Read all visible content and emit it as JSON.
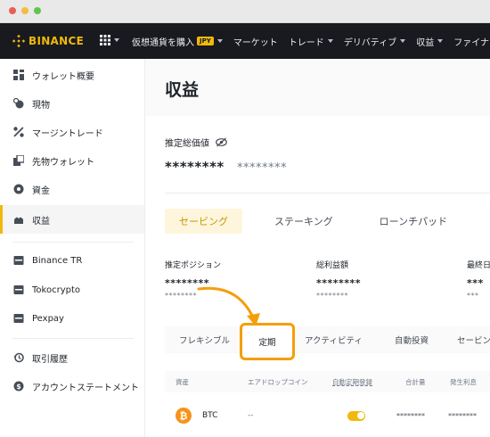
{
  "brand": {
    "name": "BINANCE",
    "accent": "#f0b90b"
  },
  "nav": {
    "items": [
      {
        "label": "仮想通貨を購入",
        "badge": "JPY",
        "has_caret": true
      },
      {
        "label": "マーケット",
        "has_caret": false
      },
      {
        "label": "トレード",
        "has_caret": true
      },
      {
        "label": "デリバティブ",
        "has_caret": true
      },
      {
        "label": "収益",
        "has_caret": true
      },
      {
        "label": "ファイナンス",
        "has_caret": false
      }
    ]
  },
  "sidebar": {
    "items": [
      {
        "label": "ウォレット概要",
        "icon": "wallet-overview-icon"
      },
      {
        "label": "現物",
        "icon": "spot-icon"
      },
      {
        "label": "マージントレード",
        "icon": "margin-icon"
      },
      {
        "label": "先物ウォレット",
        "icon": "futures-icon"
      },
      {
        "label": "資金",
        "icon": "funding-icon"
      },
      {
        "label": "収益",
        "icon": "earn-icon",
        "active": true
      },
      {
        "label": "Binance TR",
        "icon": "binance-tr-icon"
      },
      {
        "label": "Tokocrypto",
        "icon": "tokocrypto-icon"
      },
      {
        "label": "Pexpay",
        "icon": "pexpay-icon"
      },
      {
        "label": "取引履歴",
        "icon": "history-icon"
      },
      {
        "label": "アカウントステートメント",
        "icon": "statement-icon"
      }
    ]
  },
  "page": {
    "title": "収益",
    "balance_label": "推定総価値",
    "balance_main": "********",
    "balance_sub": "********"
  },
  "tabs": [
    {
      "label": "セービング",
      "active": true
    },
    {
      "label": "ステーキング"
    },
    {
      "label": "ローンチパッド"
    },
    {
      "label": "流"
    }
  ],
  "stats": [
    {
      "label": "推定ポジション",
      "value": "********",
      "sub": "********"
    },
    {
      "label": "総利益額",
      "value": "********",
      "sub": "********"
    },
    {
      "label": "最終日",
      "value": "***",
      "sub": "***"
    }
  ],
  "subtabs": [
    {
      "label": "フレキシブル"
    },
    {
      "label": "定期",
      "highlighted": true
    },
    {
      "label": "アクティビティ"
    },
    {
      "label": "自動投資"
    },
    {
      "label": "セービン"
    }
  ],
  "table": {
    "headers": [
      "資産",
      "エアドロップコイン",
      "自動定期登録",
      "合計量",
      "発生利息"
    ],
    "rows": [
      {
        "coin_symbol": "₿",
        "asset": "BTC",
        "airdrop": "--",
        "auto_subscribe": true,
        "total": "********",
        "interest": "********"
      }
    ]
  },
  "colors": {
    "highlight": "#f59e0b",
    "nav_bg": "#181a20",
    "btc": "#f7931a"
  }
}
